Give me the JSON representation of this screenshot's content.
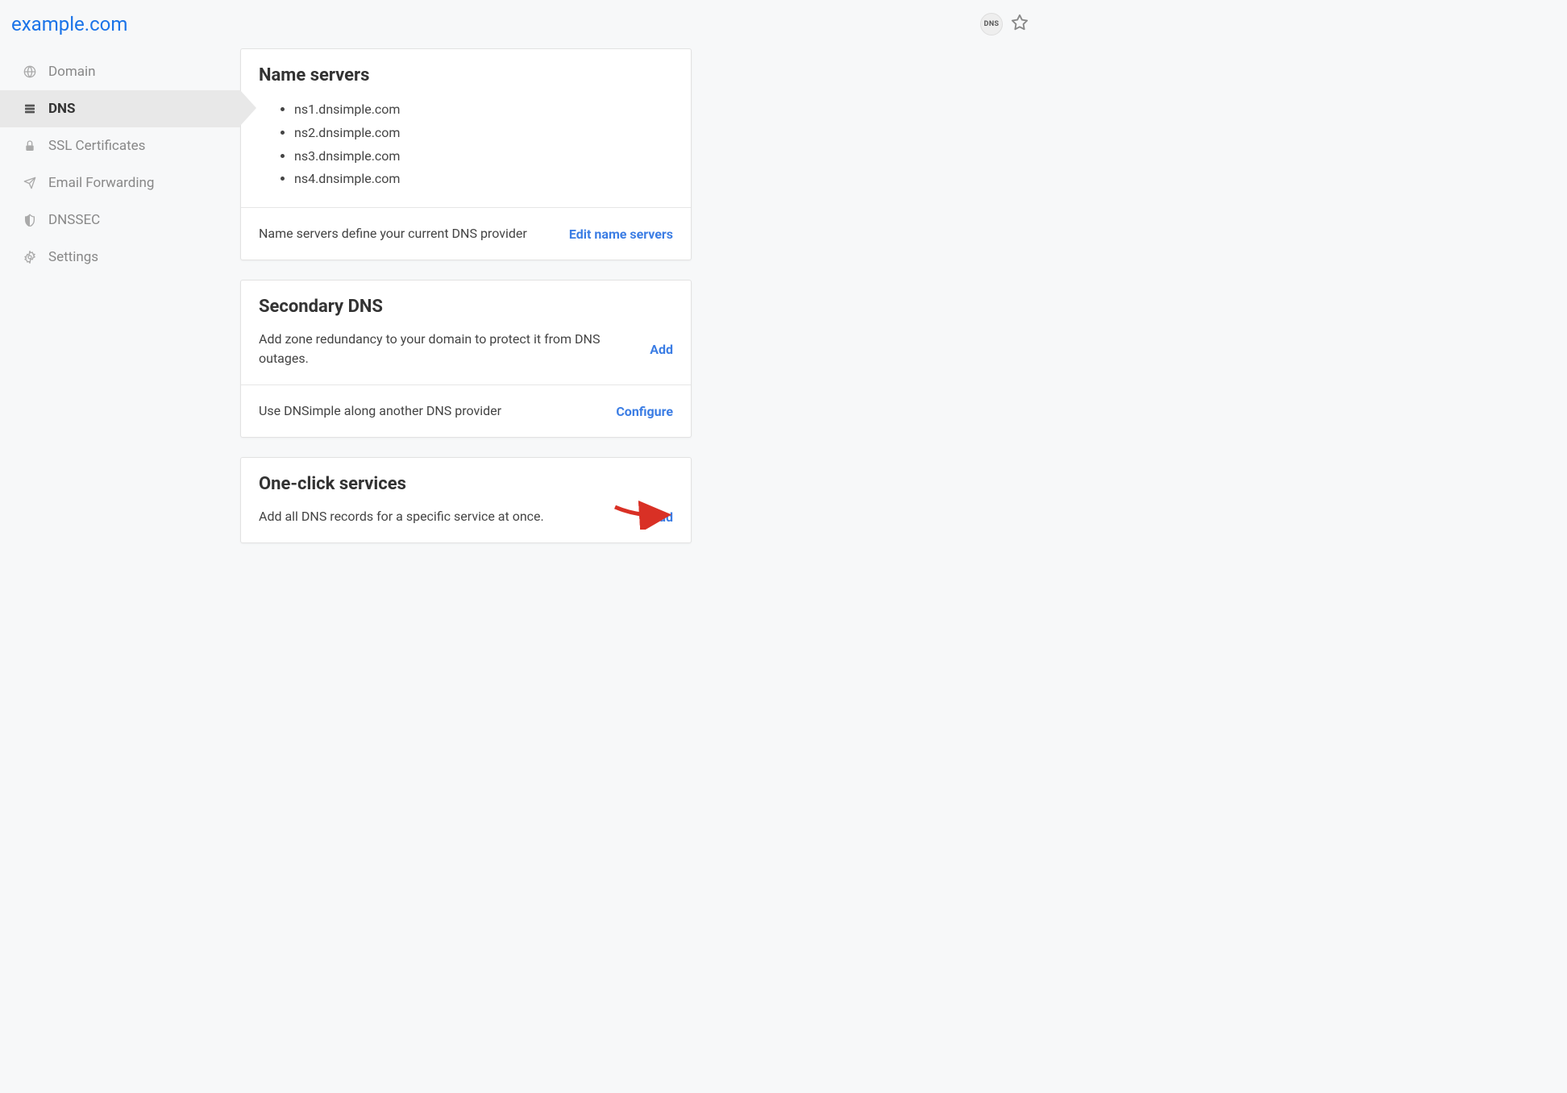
{
  "header": {
    "domain_title": "example.com",
    "dns_badge": "DNS"
  },
  "sidebar": {
    "items": [
      {
        "label": "Domain",
        "icon": "globe-icon"
      },
      {
        "label": "DNS",
        "icon": "dns-icon"
      },
      {
        "label": "SSL Certificates",
        "icon": "lock-icon"
      },
      {
        "label": "Email Forwarding",
        "icon": "paper-plane-icon"
      },
      {
        "label": "DNSSEC",
        "icon": "shield-icon"
      },
      {
        "label": "Settings",
        "icon": "gear-icon"
      }
    ]
  },
  "cards": {
    "name_servers": {
      "title": "Name servers",
      "servers": [
        "ns1.dnsimple.com",
        "ns2.dnsimple.com",
        "ns3.dnsimple.com",
        "ns4.dnsimple.com"
      ],
      "footer_text": "Name servers define your current DNS provider",
      "footer_link": "Edit name servers"
    },
    "secondary_dns": {
      "title": "Secondary DNS",
      "text": "Add zone redundancy to your domain to protect it from DNS outages.",
      "link": "Add",
      "footer_text": "Use DNSimple along another DNS provider",
      "footer_link": "Configure"
    },
    "one_click": {
      "title": "One-click services",
      "text": "Add all DNS records for a specific service at once.",
      "link": "Add"
    }
  }
}
